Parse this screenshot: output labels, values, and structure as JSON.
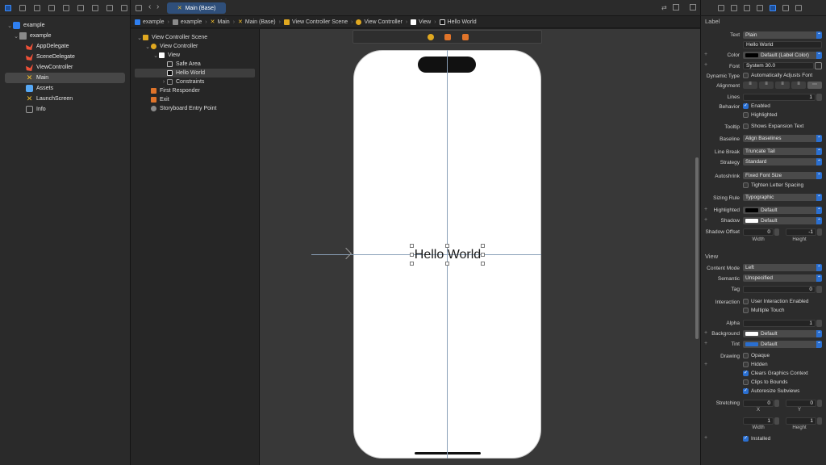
{
  "navigator": {
    "items": [
      {
        "label": "example",
        "icon": "project-icon",
        "chev": "⌄"
      },
      {
        "label": "example",
        "icon": "folder-icon",
        "chev": "⌄"
      },
      {
        "label": "AppDelegate",
        "icon": "swift-file-icon"
      },
      {
        "label": "SceneDelegate",
        "icon": "swift-file-icon"
      },
      {
        "label": "ViewController",
        "icon": "swift-file-icon"
      },
      {
        "label": "Main",
        "icon": "storyboard-icon",
        "selected": true
      },
      {
        "label": "Assets",
        "icon": "asset-catalog-icon"
      },
      {
        "label": "LaunchScreen",
        "icon": "storyboard-icon"
      },
      {
        "label": "Info",
        "icon": "plist-icon"
      }
    ]
  },
  "editor": {
    "tab_label": "Main (Base)",
    "jumpbar": [
      "example",
      "example",
      "Main",
      "Main (Base)",
      "View Controller Scene",
      "View Controller",
      "View",
      "Hello World"
    ]
  },
  "outline": {
    "items": [
      {
        "label": "View Controller Scene",
        "chev": "⌄"
      },
      {
        "label": "View Controller",
        "chev": "⌄"
      },
      {
        "label": "View",
        "chev": "⌄"
      },
      {
        "label": "Safe Area"
      },
      {
        "label": "Hello World",
        "selected": true
      },
      {
        "label": "Constraints",
        "chev": "›"
      },
      {
        "label": "First Responder"
      },
      {
        "label": "Exit"
      },
      {
        "label": "Storyboard Entry Point"
      }
    ]
  },
  "canvas": {
    "label_text": "Hello World"
  },
  "inspector": {
    "label_section": "Label",
    "text_label": "Text",
    "text_value": "Plain",
    "text_content": "Hello World",
    "color_label": "Color",
    "color_value": "Default (Label Color)",
    "font_label": "Font",
    "font_value": "System 30.0",
    "dynamic_type_label": "Dynamic Type",
    "dynamic_type_value": "Automatically Adjusts Font",
    "alignment_label": "Alignment",
    "lines_label": "Lines",
    "lines_value": "1",
    "behavior_label": "Behavior",
    "enabled_label": "Enabled",
    "highlighted_label": "Highlighted",
    "tooltip_label": "Tooltip",
    "tooltip_value": "Shows Expansion Text",
    "baseline_label": "Baseline",
    "baseline_value": "Align Baselines",
    "line_break_label": "Line Break",
    "line_break_value": "Truncate Tail",
    "strategy_label": "Strategy",
    "strategy_value": "Standard",
    "autoshrink_label": "Autoshrink",
    "autoshrink_value": "Fixed Font Size",
    "tighten_label": "Tighten Letter Spacing",
    "sizing_rule_label": "Sizing Rule",
    "sizing_rule_value": "Typographic",
    "highlighted_color_label": "Highlighted",
    "highlighted_color_value": "Default",
    "shadow_label": "Shadow",
    "shadow_value": "Default",
    "shadow_offset_label": "Shadow Offset",
    "shadow_offset_w": "0",
    "shadow_offset_h": "-1",
    "width_label": "Width",
    "height_label": "Height",
    "view_section": "View",
    "content_mode_label": "Content Mode",
    "content_mode_value": "Left",
    "semantic_label": "Semantic",
    "semantic_value": "Unspecified",
    "tag_label": "Tag",
    "tag_value": "0",
    "interaction_label": "Interaction",
    "user_interaction_label": "User Interaction Enabled",
    "multiple_touch_label": "Multiple Touch",
    "alpha_label": "Alpha",
    "alpha_value": "1",
    "background_label": "Background",
    "background_value": "Default",
    "tint_label": "Tint",
    "tint_value": "Default",
    "drawing_label": "Drawing",
    "opaque_label": "Opaque",
    "hidden_label": "Hidden",
    "clears_label": "Clears Graphics Context",
    "clips_label": "Clips to Bounds",
    "autoresize_label": "Autoresize Subviews",
    "stretching_label": "Stretching",
    "stretch_x": "0",
    "stretch_y": "0",
    "stretch_w": "1",
    "stretch_h": "1",
    "x_label": "X",
    "y_label": "Y",
    "installed_label": "Installed"
  }
}
